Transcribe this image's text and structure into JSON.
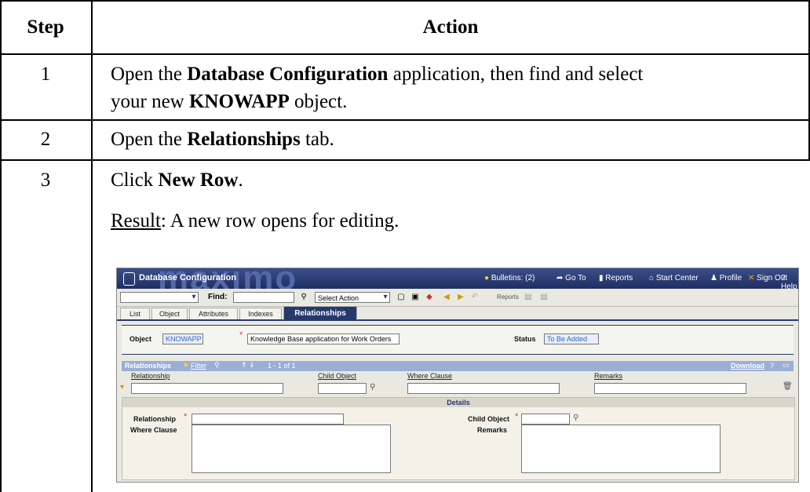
{
  "table": {
    "header": {
      "step": "Step",
      "action": "Action"
    },
    "rows": [
      {
        "step": "1",
        "parts": [
          "Open the ",
          "Database Configuration",
          " application, then find and select",
          "your new ",
          "KNOWAPP",
          " object."
        ]
      },
      {
        "step": "2",
        "parts": [
          "Open the ",
          "Relationships",
          " tab."
        ]
      },
      {
        "step": "3",
        "parts": [
          "Click ",
          "New Row",
          "."
        ],
        "result_label": "Result",
        "result_text": ": A new row opens for editing."
      }
    ]
  },
  "screenshot": {
    "brand_watermark": "maximo",
    "app_title": "Database Configuration",
    "topnav": [
      "Bulletins: (2)",
      "Go To",
      "Reports",
      "Start Center",
      "Profile",
      "Sign Out",
      "Help"
    ],
    "toolbar": {
      "find_label": "Find:",
      "select_action": "Select Action",
      "reports": "Reports"
    },
    "tabs": [
      "List",
      "Object",
      "Attributes",
      "Indexes",
      "Relationships"
    ],
    "header": {
      "object_label": "Object",
      "object_value": "KNOWAPP",
      "description": "Knowledge Base application for Work Orders",
      "status_label": "Status",
      "status_value": "To Be Added"
    },
    "table_bar": {
      "title": "Relationships",
      "filter": "Filter",
      "paging": "1 - 1 of 1",
      "download": "Download"
    },
    "columns": [
      "Relationship",
      "Child Object",
      "Where Clause",
      "Remarks"
    ],
    "details": {
      "title": "Details",
      "relationship_label": "Relationship",
      "child_object_label": "Child Object",
      "where_clause_label": "Where Clause",
      "remarks_label": "Remarks"
    }
  }
}
